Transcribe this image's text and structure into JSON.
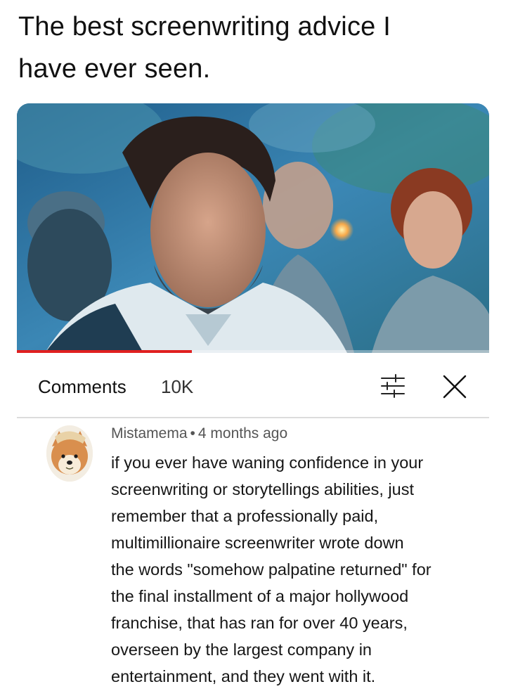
{
  "caption": {
    "line1": "The best screenwriting advice I",
    "line2": "have ever seen."
  },
  "video": {
    "progress_fraction": 0.37,
    "progress_color": "#e02020"
  },
  "comments_header": {
    "title": "Comments",
    "count": "10K",
    "filter_icon": "sliders-icon",
    "close_icon": "close-icon"
  },
  "comment": {
    "author": "Mistamema",
    "separator": "•",
    "time": "4 months ago",
    "avatar_icon": "shiba-dog-avatar",
    "lines": [
      "if you ever have waning confidence in your",
      "screenwriting or storytellings abilities, just",
      "remember that a professionally paid,",
      "multimillionaire screenwriter wrote down",
      "the words \"somehow palpatine returned\" for",
      "the final installment of a major hollywood",
      "franchise, that has ran for over 40 years,",
      "overseen by the largest company in",
      "entertainment, and they went with it."
    ]
  }
}
